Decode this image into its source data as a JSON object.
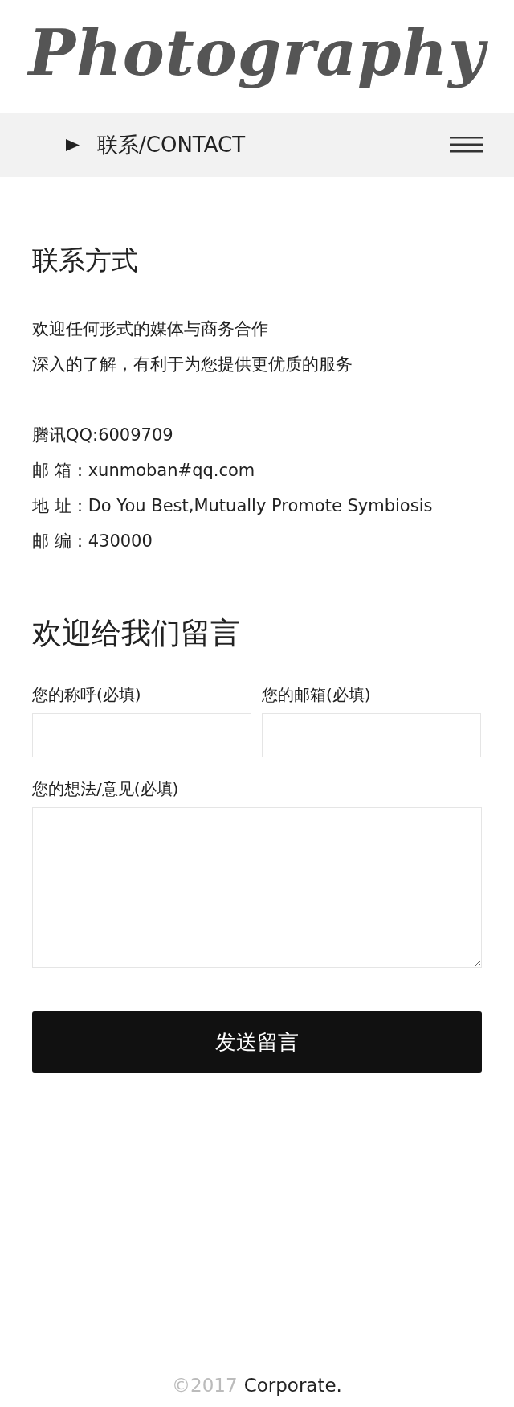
{
  "logo": "Photography",
  "nav": {
    "title": "联系/CONTACT"
  },
  "contact": {
    "heading": "联系方式",
    "intro": [
      "欢迎任何形式的媒体与商务合作",
      "深入的了解，有利于为您提供更优质的服务"
    ],
    "details": [
      "腾讯QQ:6009709",
      "邮 箱：xunmoban#qq.com",
      "地 址：Do You Best,Mutually Promote Symbiosis",
      "邮 编：430000"
    ]
  },
  "form": {
    "heading": "欢迎给我们留言",
    "fields": [
      {
        "label": "您的称呼(必填)",
        "kind": "input"
      },
      {
        "label": "您的邮箱(必填)",
        "kind": "input"
      },
      {
        "label": "您的想法/意见(必填)",
        "kind": "textarea"
      }
    ],
    "submit": "发送留言"
  },
  "footer": {
    "year": "©2017",
    "company": "Corporate."
  }
}
